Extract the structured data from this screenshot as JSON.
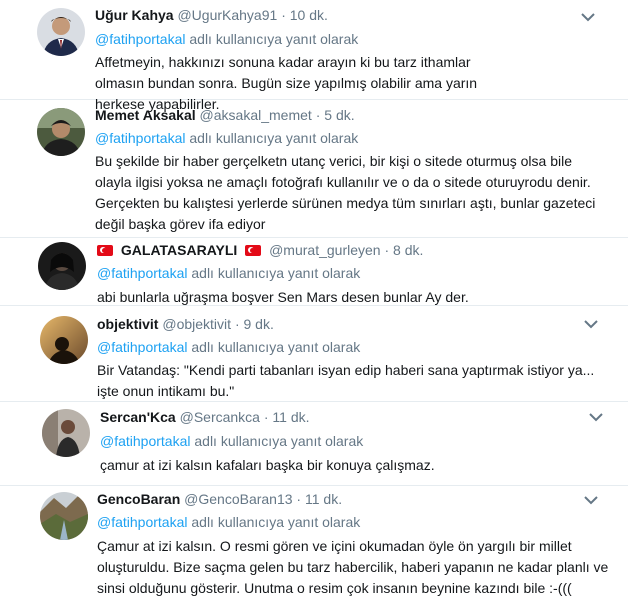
{
  "replying_suffix": "adlı kullanıcıya yanıt olarak",
  "tweets": [
    {
      "name": "Uğur Kahya",
      "handle": "@UgurKahya91",
      "time": "10 dk.",
      "mention": "@fatihportakal",
      "text": "Affetmeyin, hakkınızı sonuna kadar arayın ki bu tarz ithamlar olmasın bundan sonra. Bugün size yapılmış olabilir ama yarın herkese yapabilirler."
    },
    {
      "name": "Memet Aksakal",
      "handle": "@aksakal_memet",
      "time": "5 dk.",
      "mention": "@fatihportakal",
      "text": "Bu şekilde bir haber gerçelketn utanç verici, bir kişi o sitede oturmuş olsa bile olayla ilgisi yoksa ne amaçlı fotoğrafı kullanılır ve o da o sitede oturuyrodu denir. Gerçekten bu kalıştesi yerlerde sürünen medya tüm sınırları aştı, bunlar gazeteci değil başka görev ifa ediyor"
    },
    {
      "name": "GALATASARAYLI",
      "handle": "@murat_gurleyen",
      "time": "8 dk.",
      "mention": "@fatihportakal",
      "text": "abi bunlarla uğraşma boşver Sen Mars desen bunlar Ay der."
    },
    {
      "name": "objektivit",
      "handle": "@objektivit",
      "time": "9 dk.",
      "mention": "@fatihportakal",
      "text": "Bir Vatandaş: \"Kendi parti tabanları isyan edip haberi sana yaptırmak istiyor ya... işte onun intikamı bu.\""
    },
    {
      "name": "Sercan'Kca",
      "handle": "@Sercankca",
      "time": "11 dk.",
      "mention": "@fatihportakal",
      "text": "çamur at izi kalsın kafaları başka bir konuya çalışmaz."
    },
    {
      "name": "GencoBaran",
      "handle": "@GencoBaran13",
      "time": "11 dk.",
      "mention": "@fatihportakal",
      "text": "Çamur at izi kalsın. O resmi gören ve içini okumadan öyle ön yargılı bir millet oluşturuldu. Bize saçma gelen bu tarz habercilik, haberi yapanın ne kadar planlı ve sinsi olduğunu gösterir. Unutma o resim çok insanın beynine kazındı bile :-((("
    }
  ]
}
